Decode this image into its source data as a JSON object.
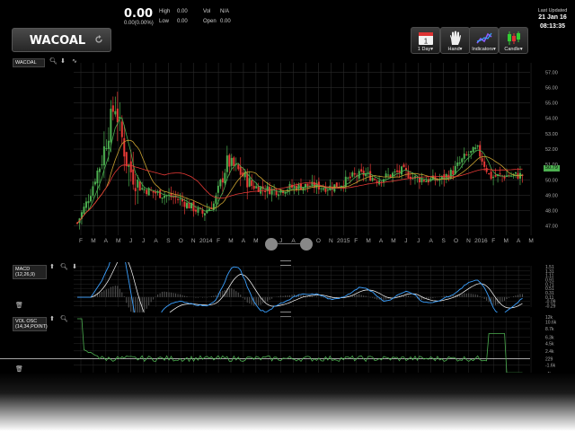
{
  "symbol": "WACOAL",
  "price": "0.00",
  "change": "0.00(0.00%)",
  "quote": {
    "high_label": "High",
    "high": "0.00",
    "low_label": "Low",
    "low": "0.00",
    "vol_label": "Vol",
    "vol": "N/A",
    "open_label": "Open",
    "open": "0.00"
  },
  "toolbar": {
    "period_label": "1 Day▾",
    "calendar_day": "1",
    "hand_label": "Hand▾",
    "indicators_label": "Indicators▾",
    "candle_label": "Candle▾"
  },
  "last_updated": {
    "label": "Last Updated",
    "date": "21 Jan 16",
    "time": "08:13:35"
  },
  "main_panel": {
    "label": "WACOAL",
    "current_price_tag": "50.79"
  },
  "macd_panel": {
    "label_line1": "MACD",
    "label_line2": "(12,26,9)"
  },
  "vol_panel": {
    "label_line1": "VOL OSC",
    "label_line2": "(14,34,POINT)"
  },
  "colors": {
    "up": "#4caf50",
    "down": "#e53935",
    "grid": "#2a2a2a",
    "macd_line": "#3aa0ff",
    "signal_line": "#ffffff",
    "ma_orange": "#c8a030",
    "price_tag": "#4caf50"
  },
  "chart_data": [
    {
      "type": "candlestick",
      "title": "",
      "x_tick_labels": [
        "F",
        "M",
        "A",
        "M",
        "J",
        "J",
        "A",
        "S",
        "O",
        "N",
        "2014",
        "F",
        "M",
        "A",
        "M",
        "J",
        "J",
        "A",
        "S",
        "O",
        "N",
        "2015",
        "F",
        "M",
        "A",
        "M",
        "J",
        "J",
        "A",
        "S",
        "O",
        "N",
        "2016",
        "F",
        "M",
        "A",
        "M"
      ],
      "y_tick_labels": [
        "47.00",
        "48.00",
        "49.00",
        "50.00",
        "51.00",
        "52.00",
        "53.00",
        "54.00",
        "55.00",
        "56.00",
        "57.00"
      ],
      "ylim": [
        46.4,
        57.6
      ],
      "approx_close_path": [
        [
          "2013-02",
          47.2
        ],
        [
          "2013-03",
          49.0
        ],
        [
          "2013-04",
          51.5
        ],
        [
          "2013-05",
          55.0
        ],
        [
          "2013-06",
          51.0
        ],
        [
          "2013-07",
          49.5
        ],
        [
          "2013-08",
          49.2
        ],
        [
          "2013-09",
          49.0
        ],
        [
          "2013-10",
          48.8
        ],
        [
          "2013-11",
          48.3
        ],
        [
          "2013-12",
          47.8
        ],
        [
          "2014-01",
          48.5
        ],
        [
          "2014-02",
          51.2
        ],
        [
          "2014-03",
          50.5
        ],
        [
          "2014-04",
          49.6
        ],
        [
          "2014-05",
          49.4
        ],
        [
          "2014-06",
          49.3
        ],
        [
          "2014-07",
          49.5
        ],
        [
          "2014-08",
          49.6
        ],
        [
          "2014-09",
          49.6
        ],
        [
          "2014-10",
          49.5
        ],
        [
          "2014-11",
          49.7
        ],
        [
          "2014-12",
          50.2
        ],
        [
          "2015-01",
          50.4
        ],
        [
          "2015-02",
          50.0
        ],
        [
          "2015-03",
          50.3
        ],
        [
          "2015-04",
          50.6
        ],
        [
          "2015-05",
          50.1
        ],
        [
          "2015-06",
          50.0
        ],
        [
          "2015-07",
          50.0
        ],
        [
          "2015-08",
          50.5
        ],
        [
          "2015-09",
          51.5
        ],
        [
          "2015-10",
          52.0
        ],
        [
          "2015-11",
          50.2
        ],
        [
          "2016-01",
          50.3
        ]
      ],
      "indicators": [
        "moving average (orange)",
        "moving average (red)",
        "moving average (green)"
      ]
    },
    {
      "type": "line",
      "name": "MACD",
      "y_tick_labels": [
        "1.51",
        "1.31",
        "1.11",
        "0.91",
        "0.71",
        "0.51",
        "0.31",
        "0.11",
        "-0.09",
        "-0.29"
      ],
      "ylim": [
        -0.35,
        1.55
      ]
    },
    {
      "type": "line",
      "name": "VOL OSC",
      "y_tick_labels": [
        "12k",
        "10.6k",
        "8.7k",
        "6.3k",
        "4.5k",
        "2.4k",
        "229",
        "-1.6k",
        "-4k"
      ],
      "ylim": [
        -4000,
        12000
      ]
    }
  ]
}
